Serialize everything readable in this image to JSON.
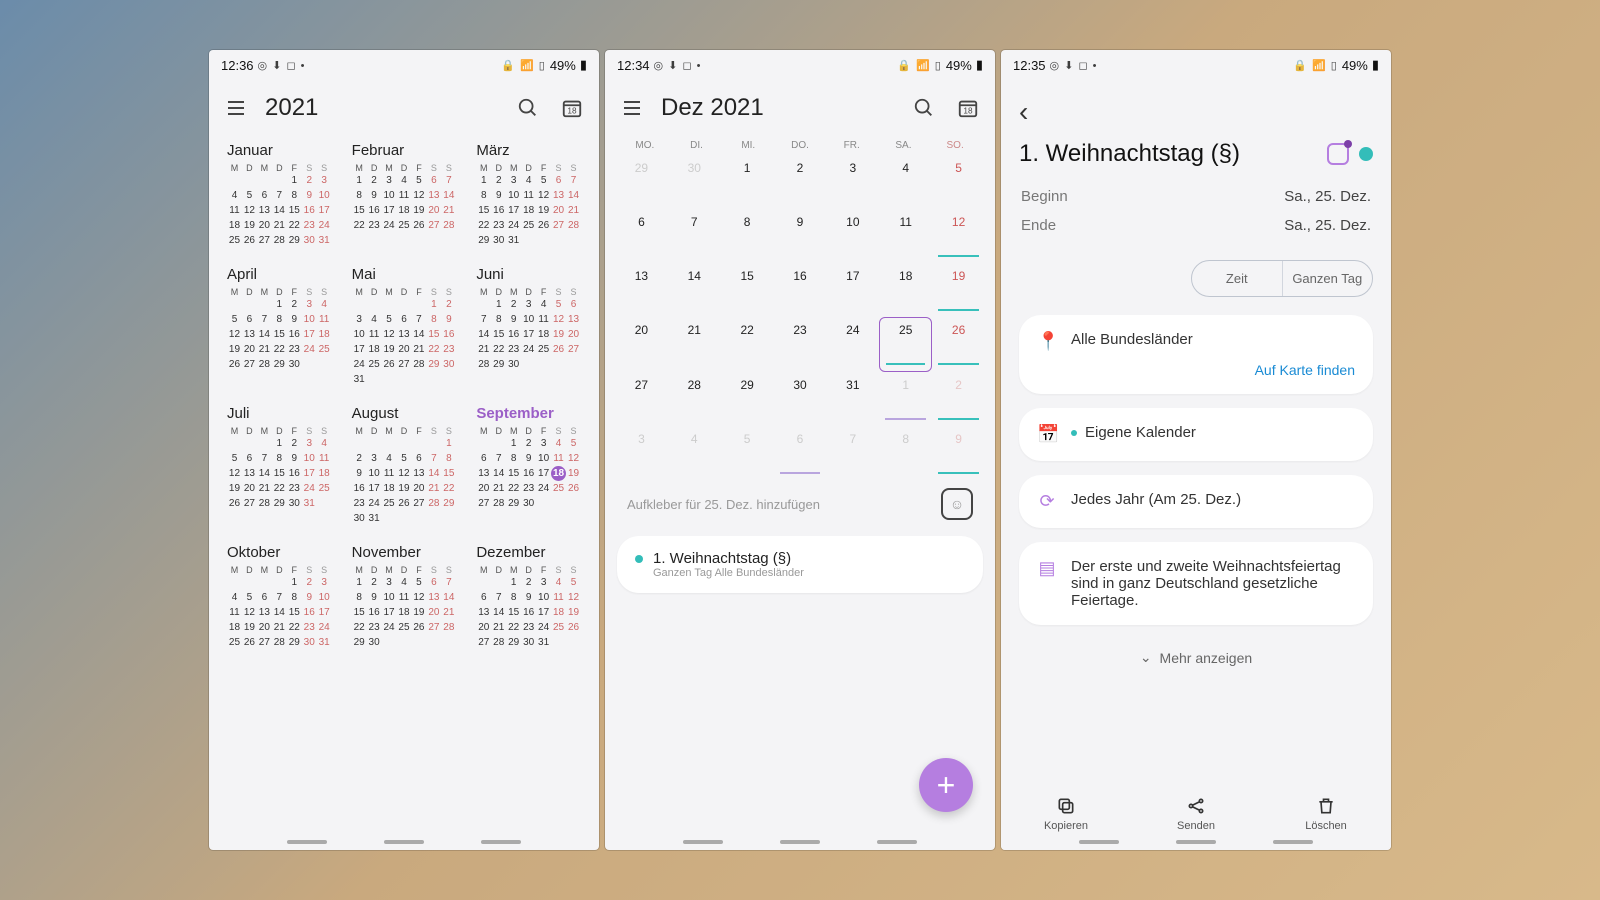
{
  "status": {
    "p1_time": "12:36",
    "p2_time": "12:34",
    "p3_time": "12:35",
    "battery": "49%",
    "icons": "◎ ⬇ ◻ •",
    "right_icons": "🔒 📶 ▮"
  },
  "p1": {
    "title": "2021",
    "dow": [
      "M",
      "D",
      "M",
      "D",
      "F",
      "S",
      "S"
    ],
    "months": [
      {
        "name": "Januar",
        "start": 4,
        "days": 31
      },
      {
        "name": "Februar",
        "start": 0,
        "days": 28
      },
      {
        "name": "März",
        "start": 0,
        "days": 31
      },
      {
        "name": "April",
        "start": 3,
        "days": 30
      },
      {
        "name": "Mai",
        "start": 5,
        "days": 31
      },
      {
        "name": "Juni",
        "start": 1,
        "days": 30
      },
      {
        "name": "Juli",
        "start": 3,
        "days": 31
      },
      {
        "name": "August",
        "start": 6,
        "days": 31
      },
      {
        "name": "September",
        "start": 2,
        "days": 30,
        "hl": true,
        "today": 18
      },
      {
        "name": "Oktober",
        "start": 4,
        "days": 31
      },
      {
        "name": "November",
        "start": 0,
        "days": 30
      },
      {
        "name": "Dezember",
        "start": 2,
        "days": 31
      }
    ]
  },
  "p2": {
    "title": "Dez 2021",
    "dow": [
      "MO.",
      "DI.",
      "MI.",
      "DO.",
      "FR.",
      "SA.",
      "SO."
    ],
    "cells": [
      {
        "n": "29",
        "fade": true
      },
      {
        "n": "30",
        "fade": true
      },
      {
        "n": "1"
      },
      {
        "n": "2"
      },
      {
        "n": "3"
      },
      {
        "n": "4"
      },
      {
        "n": "5",
        "sun": true
      },
      {
        "n": "6"
      },
      {
        "n": "7"
      },
      {
        "n": "8"
      },
      {
        "n": "9"
      },
      {
        "n": "10"
      },
      {
        "n": "11"
      },
      {
        "n": "12",
        "sun": true,
        "mark": 1
      },
      {
        "n": "13"
      },
      {
        "n": "14"
      },
      {
        "n": "15"
      },
      {
        "n": "16"
      },
      {
        "n": "17"
      },
      {
        "n": "18"
      },
      {
        "n": "19",
        "sun": true,
        "mark": 1
      },
      {
        "n": "20"
      },
      {
        "n": "21"
      },
      {
        "n": "22"
      },
      {
        "n": "23"
      },
      {
        "n": "24"
      },
      {
        "n": "25",
        "sel": true,
        "mark": 1
      },
      {
        "n": "26",
        "sun": true,
        "mark": 1
      },
      {
        "n": "27"
      },
      {
        "n": "28"
      },
      {
        "n": "29"
      },
      {
        "n": "30"
      },
      {
        "n": "31"
      },
      {
        "n": "1",
        "fade": true,
        "mark": 2
      },
      {
        "n": "2",
        "sun": true,
        "fade": true,
        "mark": 1
      },
      {
        "n": "3",
        "fade": true
      },
      {
        "n": "4",
        "fade": true
      },
      {
        "n": "5",
        "fade": true
      },
      {
        "n": "6",
        "fade": true,
        "mark": 2
      },
      {
        "n": "7",
        "fade": true
      },
      {
        "n": "8",
        "fade": true
      },
      {
        "n": "9",
        "sun": true,
        "fade": true,
        "mark": 1
      }
    ],
    "sticker_hint": "Aufkleber für 25. Dez. hinzufügen",
    "event": {
      "title": "1. Weihnachtstag (§)",
      "sub": "Ganzen Tag   Alle Bundesländer"
    }
  },
  "p3": {
    "title": "1. Weihnachtstag (§)",
    "begin_k": "Beginn",
    "begin_v": "Sa., 25. Dez.",
    "end_k": "Ende",
    "end_v": "Sa., 25. Dez.",
    "pill_time": "Zeit",
    "pill_allday": "Ganzen Tag",
    "location": "Alle Bundesländer",
    "map_link": "Auf Karte finden",
    "calendar": "Eigene Kalender",
    "repeat": "Jedes Jahr (Am 25. Dez.)",
    "note": "Der erste und zweite Weihnachtsfeiertag sind in ganz Deutschland gesetzliche Feiertage.",
    "more": "Mehr anzeigen",
    "copy": "Kopieren",
    "send": "Senden",
    "delete": "Löschen"
  }
}
